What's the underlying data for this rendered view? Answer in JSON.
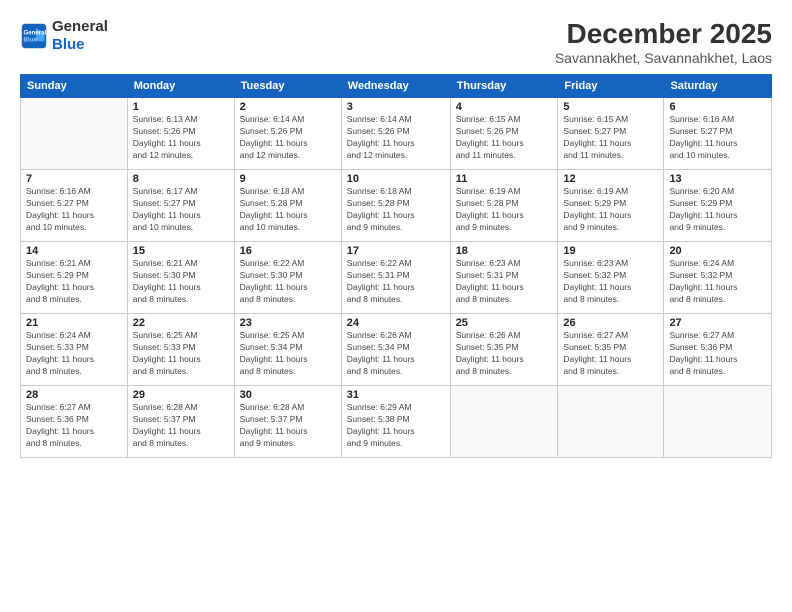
{
  "logo": {
    "line1": "General",
    "line2": "Blue"
  },
  "title": "December 2025",
  "subtitle": "Savannakhet, Savannahkhet, Laos",
  "days_header": [
    "Sunday",
    "Monday",
    "Tuesday",
    "Wednesday",
    "Thursday",
    "Friday",
    "Saturday"
  ],
  "weeks": [
    [
      {
        "num": "",
        "info": ""
      },
      {
        "num": "1",
        "info": "Sunrise: 6:13 AM\nSunset: 5:26 PM\nDaylight: 11 hours\nand 12 minutes."
      },
      {
        "num": "2",
        "info": "Sunrise: 6:14 AM\nSunset: 5:26 PM\nDaylight: 11 hours\nand 12 minutes."
      },
      {
        "num": "3",
        "info": "Sunrise: 6:14 AM\nSunset: 5:26 PM\nDaylight: 11 hours\nand 12 minutes."
      },
      {
        "num": "4",
        "info": "Sunrise: 6:15 AM\nSunset: 5:26 PM\nDaylight: 11 hours\nand 11 minutes."
      },
      {
        "num": "5",
        "info": "Sunrise: 6:15 AM\nSunset: 5:27 PM\nDaylight: 11 hours\nand 11 minutes."
      },
      {
        "num": "6",
        "info": "Sunrise: 6:16 AM\nSunset: 5:27 PM\nDaylight: 11 hours\nand 10 minutes."
      }
    ],
    [
      {
        "num": "7",
        "info": "Sunrise: 6:16 AM\nSunset: 5:27 PM\nDaylight: 11 hours\nand 10 minutes."
      },
      {
        "num": "8",
        "info": "Sunrise: 6:17 AM\nSunset: 5:27 PM\nDaylight: 11 hours\nand 10 minutes."
      },
      {
        "num": "9",
        "info": "Sunrise: 6:18 AM\nSunset: 5:28 PM\nDaylight: 11 hours\nand 10 minutes."
      },
      {
        "num": "10",
        "info": "Sunrise: 6:18 AM\nSunset: 5:28 PM\nDaylight: 11 hours\nand 9 minutes."
      },
      {
        "num": "11",
        "info": "Sunrise: 6:19 AM\nSunset: 5:28 PM\nDaylight: 11 hours\nand 9 minutes."
      },
      {
        "num": "12",
        "info": "Sunrise: 6:19 AM\nSunset: 5:29 PM\nDaylight: 11 hours\nand 9 minutes."
      },
      {
        "num": "13",
        "info": "Sunrise: 6:20 AM\nSunset: 5:29 PM\nDaylight: 11 hours\nand 9 minutes."
      }
    ],
    [
      {
        "num": "14",
        "info": "Sunrise: 6:21 AM\nSunset: 5:29 PM\nDaylight: 11 hours\nand 8 minutes."
      },
      {
        "num": "15",
        "info": "Sunrise: 6:21 AM\nSunset: 5:30 PM\nDaylight: 11 hours\nand 8 minutes."
      },
      {
        "num": "16",
        "info": "Sunrise: 6:22 AM\nSunset: 5:30 PM\nDaylight: 11 hours\nand 8 minutes."
      },
      {
        "num": "17",
        "info": "Sunrise: 6:22 AM\nSunset: 5:31 PM\nDaylight: 11 hours\nand 8 minutes."
      },
      {
        "num": "18",
        "info": "Sunrise: 6:23 AM\nSunset: 5:31 PM\nDaylight: 11 hours\nand 8 minutes."
      },
      {
        "num": "19",
        "info": "Sunrise: 6:23 AM\nSunset: 5:32 PM\nDaylight: 11 hours\nand 8 minutes."
      },
      {
        "num": "20",
        "info": "Sunrise: 6:24 AM\nSunset: 5:32 PM\nDaylight: 11 hours\nand 8 minutes."
      }
    ],
    [
      {
        "num": "21",
        "info": "Sunrise: 6:24 AM\nSunset: 5:33 PM\nDaylight: 11 hours\nand 8 minutes."
      },
      {
        "num": "22",
        "info": "Sunrise: 6:25 AM\nSunset: 5:33 PM\nDaylight: 11 hours\nand 8 minutes."
      },
      {
        "num": "23",
        "info": "Sunrise: 6:25 AM\nSunset: 5:34 PM\nDaylight: 11 hours\nand 8 minutes."
      },
      {
        "num": "24",
        "info": "Sunrise: 6:26 AM\nSunset: 5:34 PM\nDaylight: 11 hours\nand 8 minutes."
      },
      {
        "num": "25",
        "info": "Sunrise: 6:26 AM\nSunset: 5:35 PM\nDaylight: 11 hours\nand 8 minutes."
      },
      {
        "num": "26",
        "info": "Sunrise: 6:27 AM\nSunset: 5:35 PM\nDaylight: 11 hours\nand 8 minutes."
      },
      {
        "num": "27",
        "info": "Sunrise: 6:27 AM\nSunset: 5:36 PM\nDaylight: 11 hours\nand 8 minutes."
      }
    ],
    [
      {
        "num": "28",
        "info": "Sunrise: 6:27 AM\nSunset: 5:36 PM\nDaylight: 11 hours\nand 8 minutes."
      },
      {
        "num": "29",
        "info": "Sunrise: 6:28 AM\nSunset: 5:37 PM\nDaylight: 11 hours\nand 8 minutes."
      },
      {
        "num": "30",
        "info": "Sunrise: 6:28 AM\nSunset: 5:37 PM\nDaylight: 11 hours\nand 9 minutes."
      },
      {
        "num": "31",
        "info": "Sunrise: 6:29 AM\nSunset: 5:38 PM\nDaylight: 11 hours\nand 9 minutes."
      },
      {
        "num": "",
        "info": ""
      },
      {
        "num": "",
        "info": ""
      },
      {
        "num": "",
        "info": ""
      }
    ]
  ]
}
